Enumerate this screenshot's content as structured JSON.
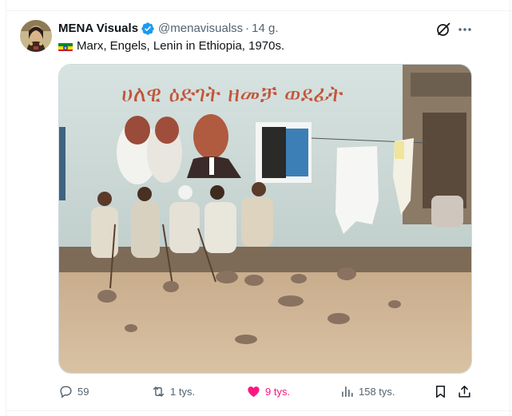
{
  "author": {
    "display_name": "MENA Visuals",
    "handle": "@menavisualss",
    "separator": "·",
    "time": "14 g."
  },
  "tweet": {
    "flag": "ethiopia-flag",
    "text": "Marx, Engels, Lenin in Ethiopia, 1970s."
  },
  "photo": {
    "mural_text": "ሀለዊ ዕድገት ዘመቻ ወደፊት"
  },
  "actions": {
    "replies": "59",
    "retweets": "1 tys.",
    "likes": "9 tys.",
    "views": "158 tys."
  },
  "colors": {
    "verified_blue": "#1d9bf0",
    "like_pink": "#f91880",
    "muted_gray": "#536471",
    "border": "#cfd9de"
  }
}
